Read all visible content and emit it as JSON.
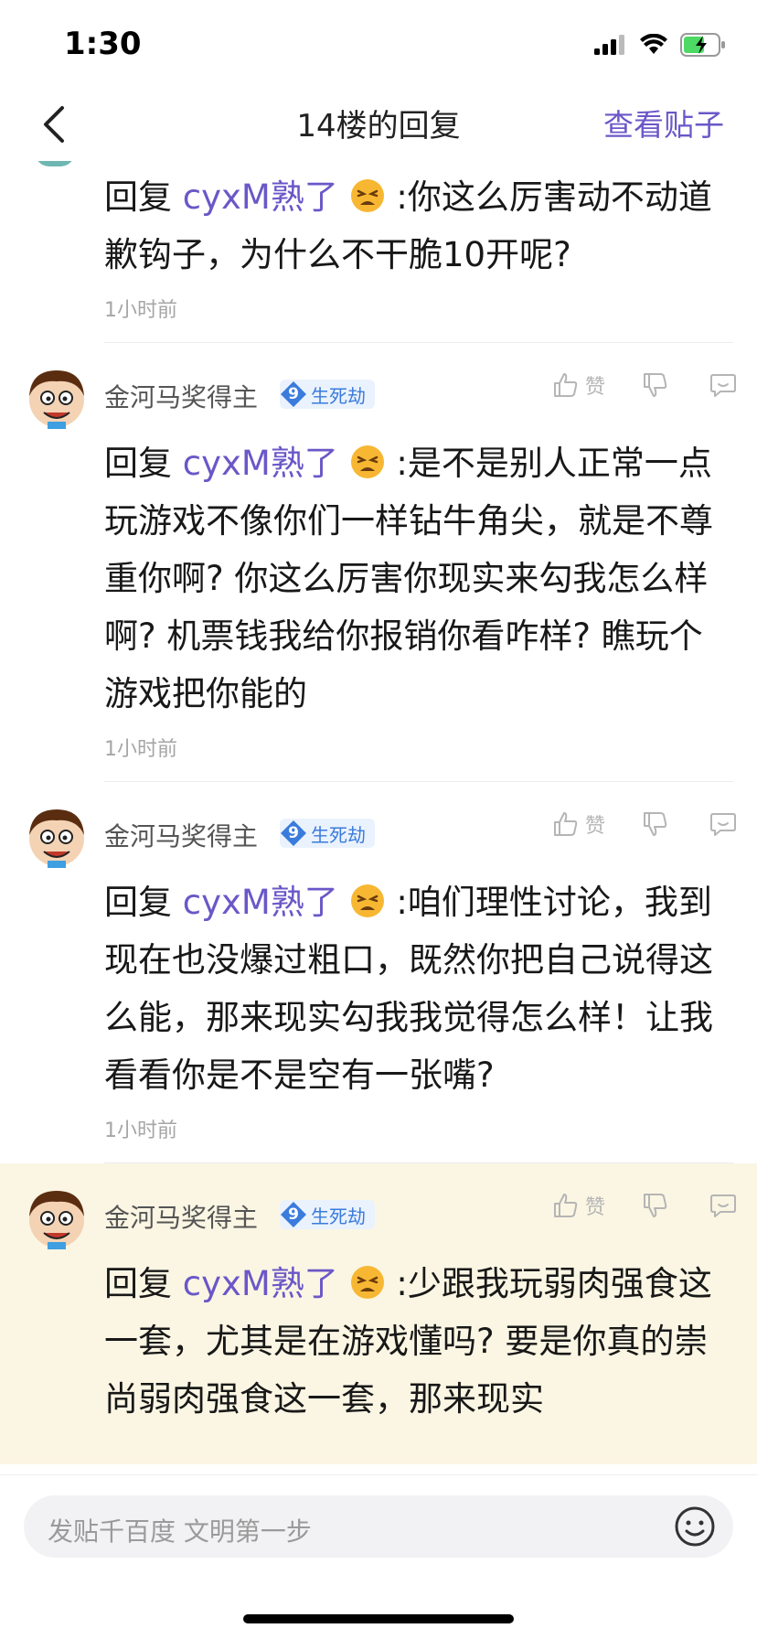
{
  "status_bar": {
    "time": "1:30"
  },
  "header": {
    "title": "14楼的回复",
    "view_post": "查看贴子"
  },
  "colors": {
    "accent": "#6b57c8",
    "badge_blue": "#3a7bdc",
    "highlight_bg": "#fbf6e3"
  },
  "first_reply": {
    "reply_prefix": "回复",
    "mention": "cyxM熟了",
    "text": ":你这么厉害动不动道歉钩子，为什么不干脆10开呢?",
    "time": "1小时前"
  },
  "replies": [
    {
      "username": "金河马奖得主",
      "level": "9",
      "badge": "生死劫",
      "like_label": "赞",
      "reply_prefix": "回复",
      "mention": "cyxM熟了",
      "text": ":是不是别人正常一点玩游戏不像你们一样钻牛角尖，就是不尊重你啊? 你这么厉害你现实来勾我怎么样啊? 机票钱我给你报销你看咋样? 瞧玩个游戏把你能的",
      "time": "1小时前"
    },
    {
      "username": "金河马奖得主",
      "level": "9",
      "badge": "生死劫",
      "like_label": "赞",
      "reply_prefix": "回复",
      "mention": "cyxM熟了",
      "text": ":咱们理性讨论，我到现在也没爆过粗口，既然你把自己说得这么能，那来现实勾我我觉得怎么样！让我看看你是不是空有一张嘴?",
      "time": "1小时前"
    },
    {
      "username": "金河马奖得主",
      "level": "9",
      "badge": "生死劫",
      "like_label": "赞",
      "reply_prefix": "回复",
      "mention": "cyxM熟了",
      "text": ":少跟我玩弱肉强食这一套，尤其是在游戏懂吗? 要是你真的崇尚弱肉强食这一套，那来现实",
      "time": ""
    }
  ],
  "bottom": {
    "placeholder": "发贴千百度 文明第一步"
  }
}
